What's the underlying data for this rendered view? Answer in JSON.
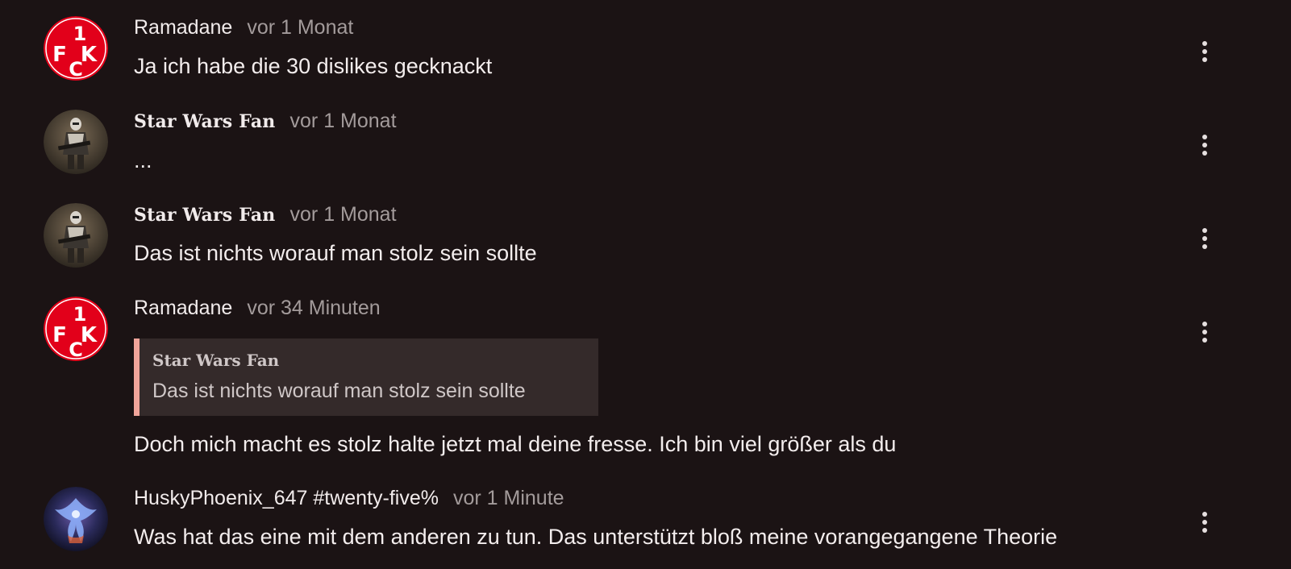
{
  "comments": [
    {
      "author": "Ramadane",
      "time": "vor 1 Monat",
      "text": "Ja ich habe die 30 dislikes gecknackt",
      "avatar": "fck-logo-avatar"
    },
    {
      "author": "Star Wars Fan",
      "time": "vor 1 Monat",
      "text": "...",
      "avatar": "clone-trooper-avatar"
    },
    {
      "author": "Star Wars Fan",
      "time": "vor 1 Monat",
      "text": "Das ist nichts worauf man stolz sein sollte",
      "avatar": "clone-trooper-avatar"
    },
    {
      "author": "Ramadane",
      "time": "vor 34 Minuten",
      "quote": {
        "author": "Star Wars Fan",
        "text": "Das ist nichts worauf man stolz sein sollte"
      },
      "text": "Doch mich macht es stolz halte jetzt mal deine fresse. Ich bin viel größer als du",
      "avatar": "fck-logo-avatar"
    },
    {
      "author": "HuskyPhoenix_647 #twenty-five%",
      "time": "vor 1 Minute",
      "text": "Was hat das eine mit dem anderen zu tun. Das unterstützt bloß meine vorangegangene Theorie",
      "avatar": "phoenix-avatar"
    }
  ],
  "more_icon": "more-vertical-icon",
  "colors": {
    "background": "#1b1314",
    "text": "#f3eded",
    "muted": "#a39b9b",
    "quote_background": "#342a2a",
    "quote_accent": "#f0a49a",
    "logo_red": "#e2001a"
  }
}
